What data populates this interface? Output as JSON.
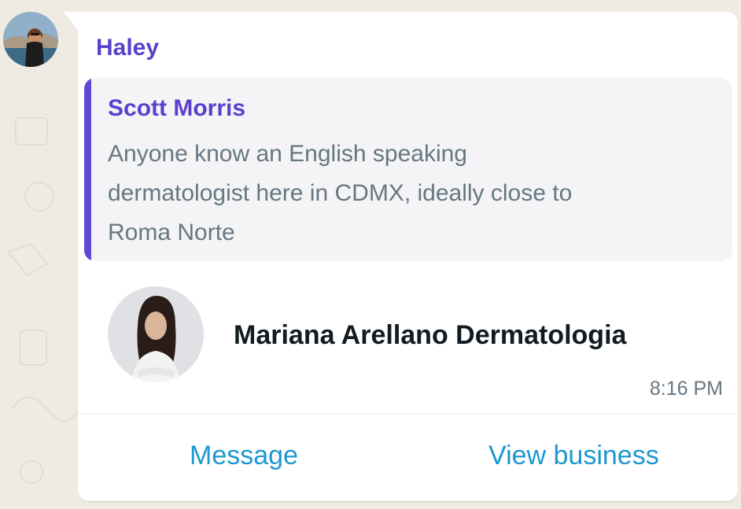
{
  "chat": {
    "sender_name": "Haley",
    "quoted_message": {
      "author": "Scott Morris",
      "text": "Anyone know an English speaking dermatologist here in CDMX, ideally close to Roma Norte"
    },
    "contact_card": {
      "name": "Mariana Arellano Dermatologia",
      "time": "8:16 PM",
      "actions": {
        "message": "Message",
        "view_business": "View business"
      }
    }
  },
  "colors": {
    "sender_name": "#5b3fcf",
    "quote_bar": "#6049d8",
    "action_link": "#1d98d1",
    "chat_background": "#efeae2"
  }
}
